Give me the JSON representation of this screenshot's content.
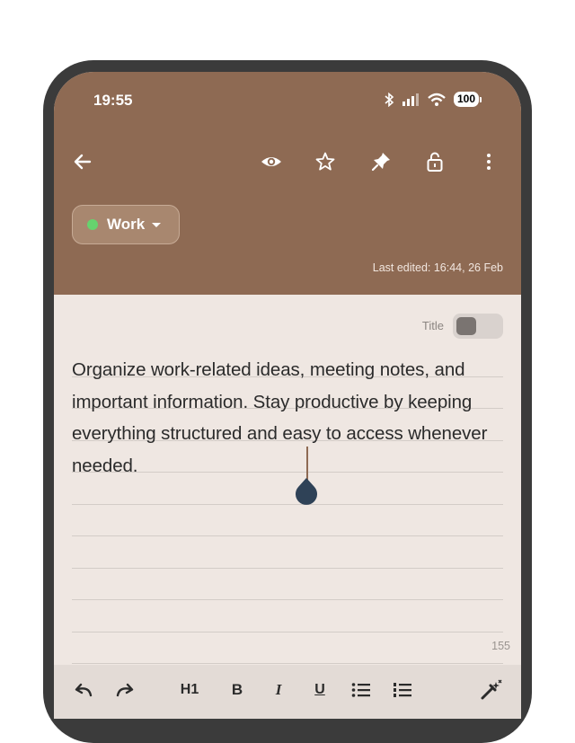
{
  "status_bar": {
    "time": "19:55",
    "battery": "100"
  },
  "header_actions": [
    "back-icon",
    "eye-icon",
    "star-icon",
    "pin-icon",
    "lock-open-icon",
    "more-vert-icon"
  ],
  "category": {
    "label": "Work",
    "dot_color": "#66d36e"
  },
  "last_edited": "Last edited: 16:44, 26 Feb",
  "title_toggle": {
    "label": "Title",
    "enabled": false
  },
  "note": {
    "text": "Organize work-related ideas, meeting notes, and important information. Stay productive by keeping everything structured and easy to access whenever needed."
  },
  "char_count": "155",
  "format_bar": {
    "h1": "H1",
    "bold": "B",
    "italic": "I",
    "underline": "U"
  },
  "colors": {
    "header": "#8e6a53",
    "page": "#efe7e2",
    "toolbar": "#e3dbd6"
  }
}
